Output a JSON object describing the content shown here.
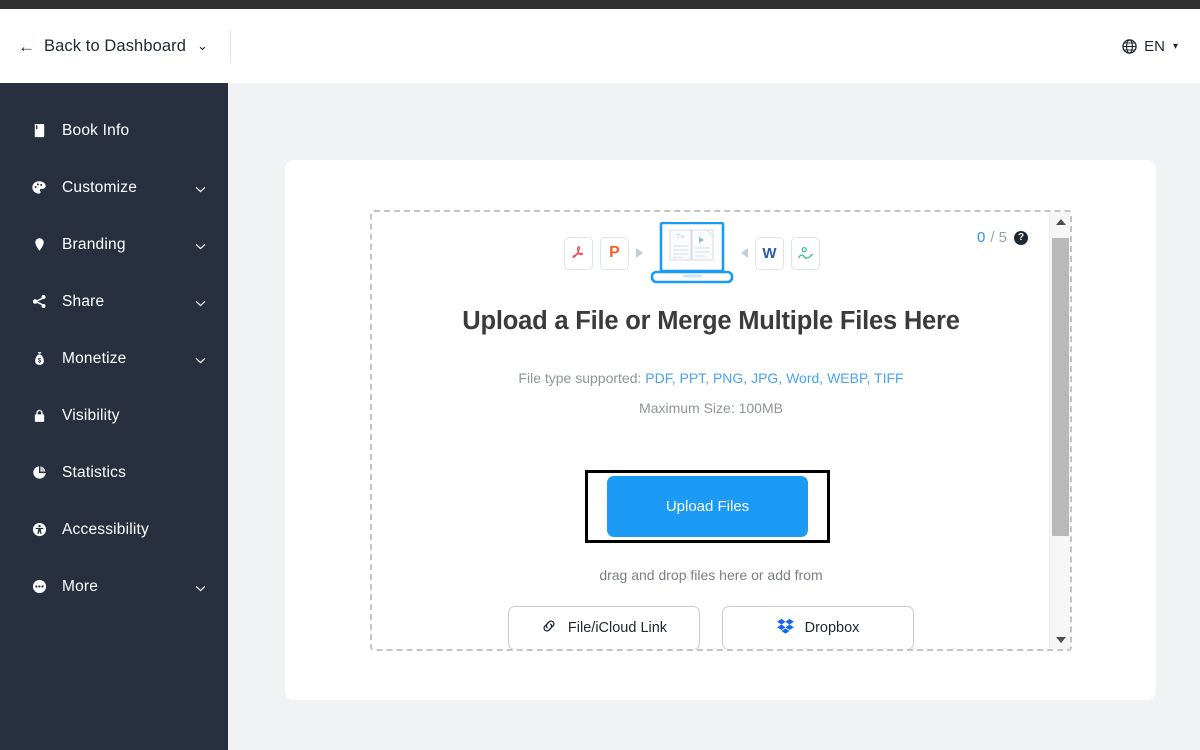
{
  "header": {
    "back_arrow": "←",
    "back_label": "Back to Dashboard",
    "back_caret": "⌄",
    "language_icon": "globe-icon",
    "language_label": "EN",
    "language_caret": "▾"
  },
  "sidebar": {
    "background": "#283040",
    "items": [
      {
        "label": "Book Info",
        "icon": "book-icon",
        "expandable": false,
        "caret": ""
      },
      {
        "label": "Customize",
        "icon": "palette-icon",
        "expandable": true,
        "caret": "⌄"
      },
      {
        "label": "Branding",
        "icon": "tag-icon",
        "expandable": true,
        "caret": "⌄"
      },
      {
        "label": "Share",
        "icon": "share-icon",
        "expandable": true,
        "caret": "⌄"
      },
      {
        "label": "Monetize",
        "icon": "money-bag-icon",
        "expandable": true,
        "caret": "⌄"
      },
      {
        "label": "Visibility",
        "icon": "lock-icon",
        "expandable": false,
        "caret": ""
      },
      {
        "label": "Statistics",
        "icon": "pie-chart-icon",
        "expandable": false,
        "caret": ""
      },
      {
        "label": "Accessibility",
        "icon": "accessibility-icon",
        "expandable": false,
        "caret": ""
      },
      {
        "label": "More",
        "icon": "ellipsis-icon",
        "expandable": true,
        "caret": "⌄"
      }
    ]
  },
  "dropzone": {
    "counter_current": "0",
    "counter_total": "/ 5",
    "help_glyph": "?",
    "file_tiles": [
      {
        "name": "pdf-file-icon",
        "glyph": "pdf",
        "color": "#f04f5f"
      },
      {
        "name": "ppt-file-icon",
        "glyph": "P",
        "color": "#f4622c"
      },
      {
        "name": "word-file-icon",
        "glyph": "W",
        "color": "#2a5caa"
      },
      {
        "name": "image-file-icon",
        "glyph": "img",
        "color": "#3ec28f"
      }
    ],
    "title": "Upload a File or Merge Multiple Files Here",
    "types_prefix": "File type supported: ",
    "types_list": "PDF, PPT, PNG, JPG, Word, WEBP, TIFF",
    "max_size": "Maximum Size: 100MB",
    "upload_button": "Upload Files",
    "drag_hint": "drag and drop files here or add from",
    "sources": [
      {
        "label": "File/iCloud Link",
        "icon": "link-icon"
      },
      {
        "label": "Dropbox",
        "icon": "dropbox-icon"
      }
    ],
    "accent_blue": "#1b9bf5",
    "link_blue": "#4aa3f0"
  }
}
